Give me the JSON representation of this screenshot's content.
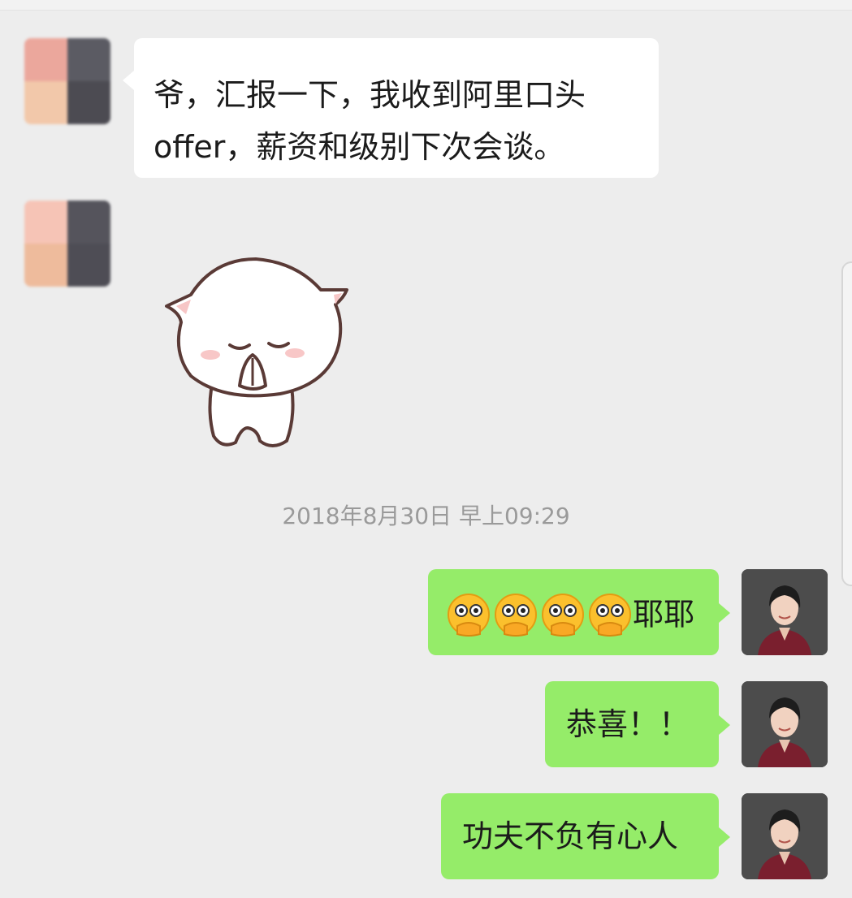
{
  "chat": {
    "messages": [
      {
        "side": "left",
        "type": "text",
        "lines": [
          "爷，汇报一下，我收到阿里口头",
          "offer，薪资和级别下次会谈。"
        ]
      },
      {
        "side": "left",
        "type": "sticker",
        "sticker": "praying-cat-sticker"
      },
      {
        "type": "timestamp",
        "text": "2018年8月30日 早上09:29"
      },
      {
        "side": "right",
        "type": "text",
        "emoji": "hand-over-mouth-emoji",
        "emoji_count": 4,
        "text": "耶耶"
      },
      {
        "side": "right",
        "type": "text",
        "text": "恭喜！！"
      },
      {
        "side": "right",
        "type": "text",
        "text": "功夫不负有心人"
      }
    ]
  },
  "colors": {
    "background": "#ededed",
    "bubble_left": "#ffffff",
    "bubble_right": "#95ec69",
    "timestamp_text": "#9a9a9a"
  }
}
